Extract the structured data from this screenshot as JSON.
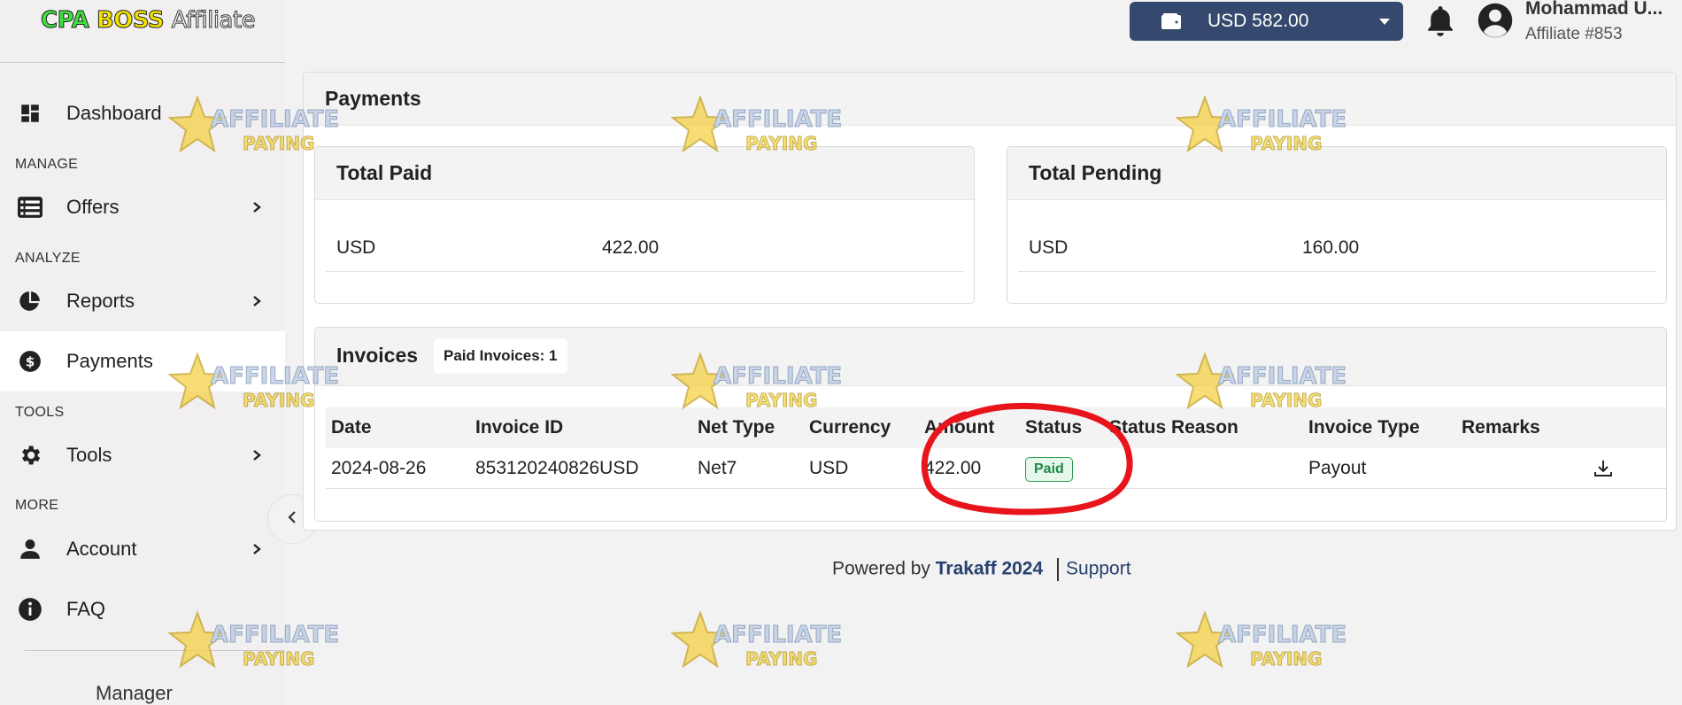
{
  "logo": {
    "part1": "CPA",
    "part2": "BOSS",
    "part3": "Affiliate"
  },
  "sidebar": {
    "dashboard": "Dashboard",
    "sections": {
      "manage": "MANAGE",
      "analyze": "ANALYZE",
      "tools": "TOOLS",
      "more": "MORE"
    },
    "offers": "Offers",
    "reports": "Reports",
    "payments": "Payments",
    "tools": "Tools",
    "account": "Account",
    "faq": "FAQ",
    "manager": "Manager"
  },
  "header": {
    "wallet_balance": "USD 582.00",
    "user_name": "Mohammad U...",
    "affiliate_id": "Affiliate #853"
  },
  "payments": {
    "title": "Payments",
    "total_paid": {
      "title": "Total Paid",
      "currency": "USD",
      "amount": "422.00"
    },
    "total_pending": {
      "title": "Total Pending",
      "currency": "USD",
      "amount": "160.00"
    },
    "invoices": {
      "title": "Invoices",
      "count_label": "Paid Invoices: 1",
      "columns": [
        "Date",
        "Invoice ID",
        "Net Type",
        "Currency",
        "Amount",
        "Status",
        "Status Reason",
        "Invoice Type",
        "Remarks"
      ],
      "rows": [
        {
          "date": "2024-08-26",
          "invoice_id": "853120240826USD",
          "net_type": "Net7",
          "currency": "USD",
          "amount": "422.00",
          "status": "Paid",
          "status_reason": "",
          "invoice_type": "Payout",
          "remarks": ""
        }
      ]
    }
  },
  "footer": {
    "powered_by": "Powered by",
    "brand": "Trakaff 2024",
    "support": "Support"
  },
  "watermark": {
    "line1": "AFFILIATE",
    "line2": "PAYING"
  },
  "colors": {
    "wallet_bg": "#34496d",
    "paid_green": "#1f8a42",
    "annotation_red": "#e8141b"
  }
}
